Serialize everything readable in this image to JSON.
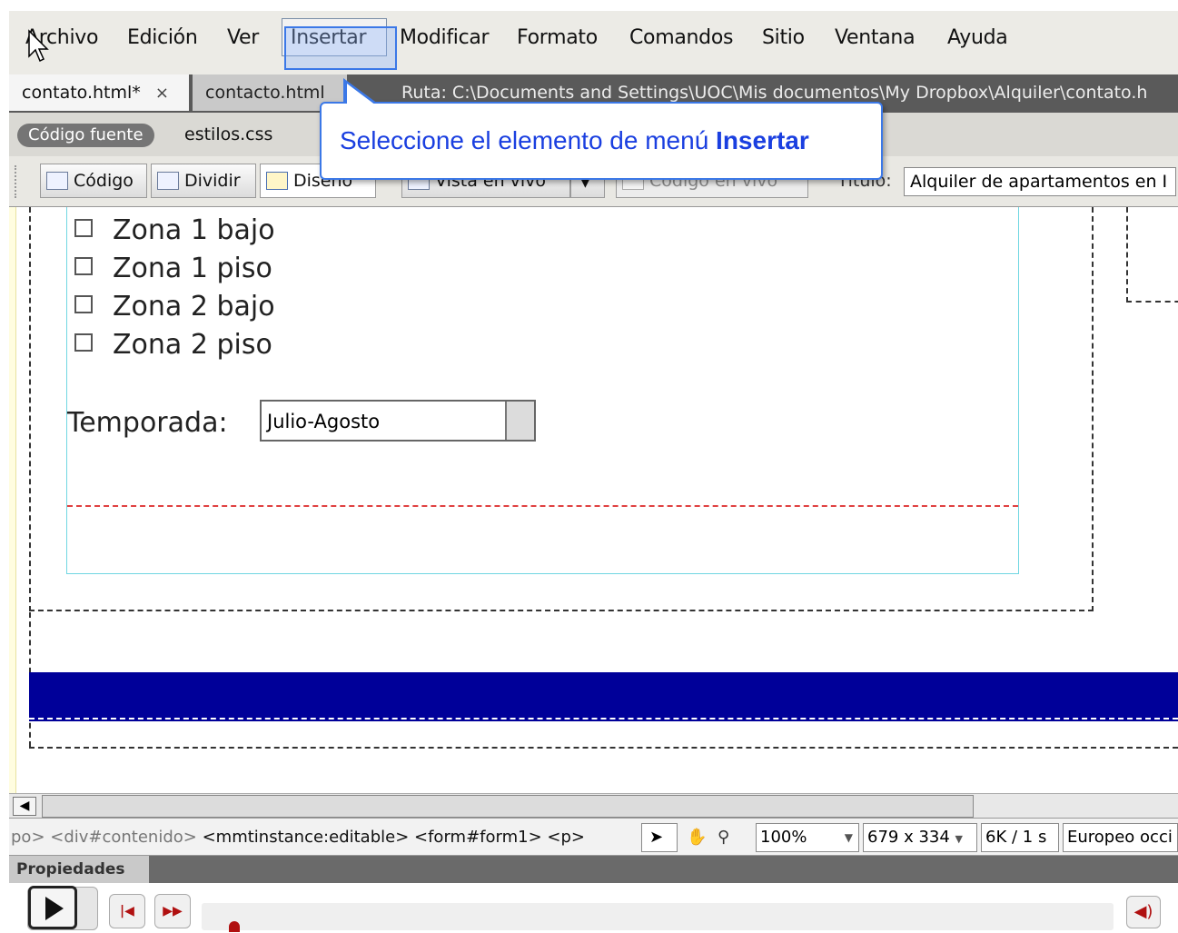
{
  "menu": {
    "items": [
      "Archivo",
      "Edición",
      "Ver",
      "Insertar",
      "Modificar",
      "Formato",
      "Comandos",
      "Sitio",
      "Ventana",
      "Ayuda"
    ]
  },
  "tabs": {
    "active": "contato.html*",
    "close_glyph": "×",
    "inactive": "contacto.html",
    "ruta": "Ruta:  C:\\Documents and Settings\\UOC\\Mis documentos\\My Dropbox\\Alquiler\\contato.h"
  },
  "related_files": {
    "source": "Código fuente",
    "css": "estilos.css"
  },
  "toolbar": {
    "codigo": "Código",
    "dividir": "Dividir",
    "diseno": "Diseño",
    "vista": "Vista en vivo",
    "codigo_vivo": "Código en vivo",
    "titulo_label": "Título:",
    "titulo_value": "Alquiler de apartamentos en I"
  },
  "callout": {
    "text": "Seleccione el elemento de menú ",
    "bold": "Insertar"
  },
  "form": {
    "checkboxes": [
      "Zona 1 bajo",
      "Zona 1 piso",
      "Zona 2 bajo",
      "Zona 2 piso"
    ],
    "temporada_label": "Temporada:",
    "temporada_value": "Julio-Agosto"
  },
  "statusbar": {
    "tags_faded": "po> <div#contenido>",
    "tags": " <mmtinstance:editable> <form#form1> <p>",
    "zoom": "100%",
    "dimensions": "679 x 334",
    "size": "6K / 1 s",
    "encoding": "Europeo occi"
  },
  "properties": {
    "label": "Propiedades"
  },
  "icons": {
    "play": "play-icon",
    "rewind": "rewind-icon",
    "fast_forward": "fast-forward-icon",
    "volume": "volume-icon"
  },
  "colors": {
    "callout_border": "#3b78e7",
    "callout_text": "#1a3fe0",
    "footer_bar": "#000099"
  }
}
